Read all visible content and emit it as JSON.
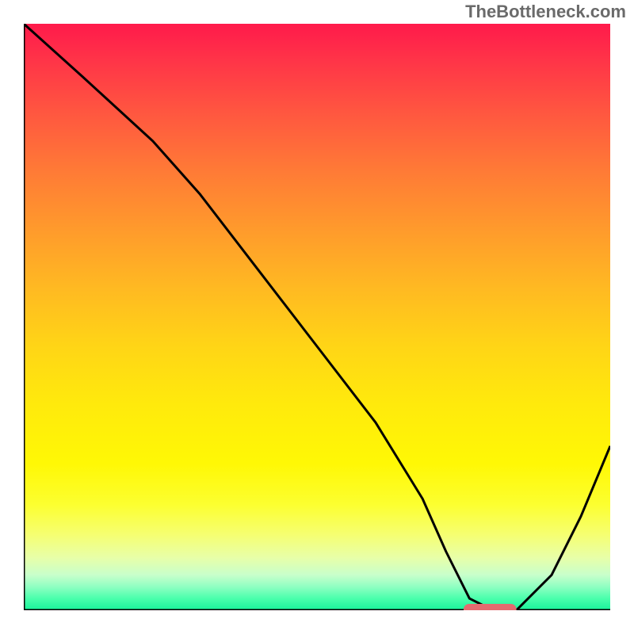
{
  "watermark": "TheBottleneck.com",
  "chart_data": {
    "type": "line",
    "title": "",
    "xlabel": "",
    "ylabel": "",
    "xlim": [
      0,
      100
    ],
    "ylim": [
      0,
      100
    ],
    "x": [
      0,
      10,
      22,
      30,
      40,
      50,
      60,
      68,
      72,
      76,
      80,
      84,
      90,
      95,
      100
    ],
    "values": [
      100,
      91,
      80,
      71,
      58,
      45,
      32,
      19,
      10,
      2,
      0,
      0,
      6,
      16,
      28
    ],
    "marker": {
      "x_start": 75,
      "x_end": 84,
      "y": 0
    },
    "gradient_note": "background vertical gradient red->yellow->green representing bottleneck severity"
  }
}
